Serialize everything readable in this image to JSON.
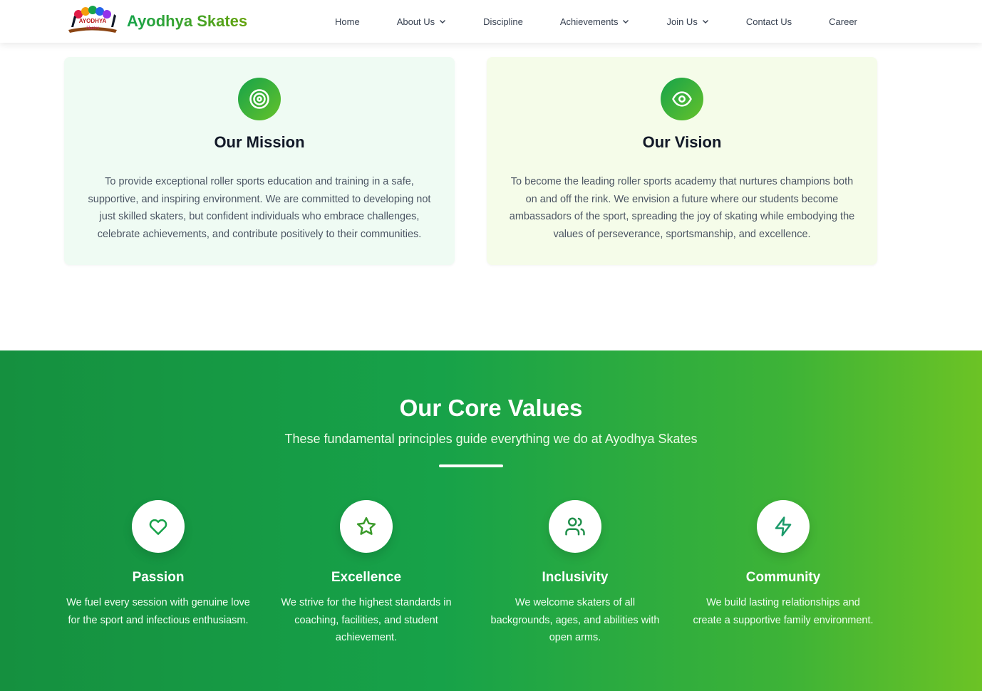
{
  "brand": {
    "name": "Ayodhya Skates",
    "logo_text": "AYODHYA",
    "logo_subtext": "Skates"
  },
  "nav": {
    "items": [
      {
        "label": "Home"
      },
      {
        "label": "About Us"
      },
      {
        "label": "Discipline"
      },
      {
        "label": "Achievements"
      },
      {
        "label": "Join Us"
      },
      {
        "label": "Contact Us"
      },
      {
        "label": "Career"
      }
    ]
  },
  "mission": {
    "icon": "target-icon",
    "title": "Our Mission",
    "text": "To provide exceptional roller sports education and training in a safe, supportive, and inspiring environment. We are committed to developing not just skilled skaters, but confident individuals who embrace challenges, celebrate achievements, and contribute positively to their communities."
  },
  "vision": {
    "icon": "eye-icon",
    "title": "Our Vision",
    "text": "To become the leading roller sports academy that nurtures champions both on and off the rink. We envision a future where our students become ambassadors of the sport, spreading the joy of skating while embodying the values of perseverance, sportsmanship, and excellence."
  },
  "core_values": {
    "title": "Our Core Values",
    "subtitle": "These fundamental principles guide everything we do at Ayodhya Skates",
    "items": [
      {
        "icon": "heart-icon",
        "title": "Passion",
        "text": "We fuel every session with genuine love for the sport and infectious enthusiasm."
      },
      {
        "icon": "star-icon",
        "title": "Excellence",
        "text": "We strive for the highest standards in coaching, facilities, and student achievement."
      },
      {
        "icon": "users-icon",
        "title": "Inclusivity",
        "text": "We welcome skaters of all backgrounds, ages, and abilities with open arms."
      },
      {
        "icon": "lightning-icon",
        "title": "Community",
        "text": "We build lasting relationships and create a supportive family environment."
      }
    ]
  },
  "colors": {
    "primary_green": "#16a34a",
    "accent_lime": "#65c22a",
    "mission_bg": "#effbf3",
    "vision_bg": "#f5fce9"
  }
}
